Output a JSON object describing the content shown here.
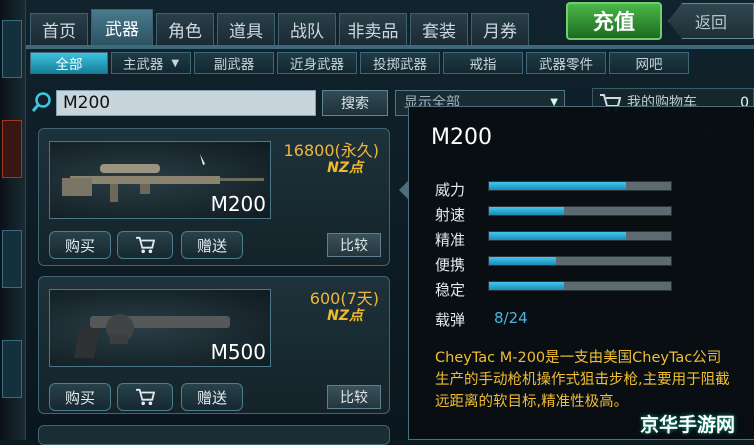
{
  "tabs": [
    {
      "label": "首页",
      "active": false
    },
    {
      "label": "武器",
      "active": true
    },
    {
      "label": "角色",
      "active": false
    },
    {
      "label": "道具",
      "active": false
    },
    {
      "label": "战队",
      "active": false
    },
    {
      "label": "非卖品",
      "active": false
    },
    {
      "label": "套装",
      "active": false
    },
    {
      "label": "月券",
      "active": false
    }
  ],
  "recharge_label": "充值",
  "back_label": "返回",
  "subtabs": [
    {
      "label": "全部",
      "active": true
    },
    {
      "label": "主武器",
      "active": false,
      "dropdown": true
    },
    {
      "label": "副武器",
      "active": false
    },
    {
      "label": "近身武器",
      "active": false
    },
    {
      "label": "投掷武器",
      "active": false
    },
    {
      "label": "戒指",
      "active": false
    },
    {
      "label": "武器零件",
      "active": false
    },
    {
      "label": "网吧",
      "active": false
    }
  ],
  "search": {
    "value": "M200",
    "button": "搜索"
  },
  "filter": {
    "value": "显示全部"
  },
  "cart": {
    "label": "我的购物车",
    "count": "0"
  },
  "items": [
    {
      "name": "M200",
      "price": "16800(永久)",
      "currency": "NZ点",
      "buy": "购买",
      "gift": "赠送",
      "compare": "比较"
    },
    {
      "name": "M500",
      "price": "600(7天)",
      "currency": "NZ点",
      "buy": "购买",
      "gift": "赠送",
      "compare": "比较"
    }
  ],
  "detail": {
    "title": "M200",
    "stats": [
      {
        "label": "威力",
        "value": 0.75
      },
      {
        "label": "射速",
        "value": 0.41
      },
      {
        "label": "精准",
        "value": 0.75
      },
      {
        "label": "便携",
        "value": 0.37
      },
      {
        "label": "稳定",
        "value": 0.41
      }
    ],
    "ammo_label": "载弹",
    "ammo_value": "8/24",
    "description": "CheyTac M-200是一支由美国CheyTac公司生产的手动枪机操作式狙击步枪,主要用于阻截远距离的软目标,精准性极高。"
  },
  "watermark": "京华手游网",
  "colors": {
    "accent": "#3cc3e0",
    "price": "#f0b63b",
    "recharge": "#49b748",
    "description": "#f1bd35"
  }
}
